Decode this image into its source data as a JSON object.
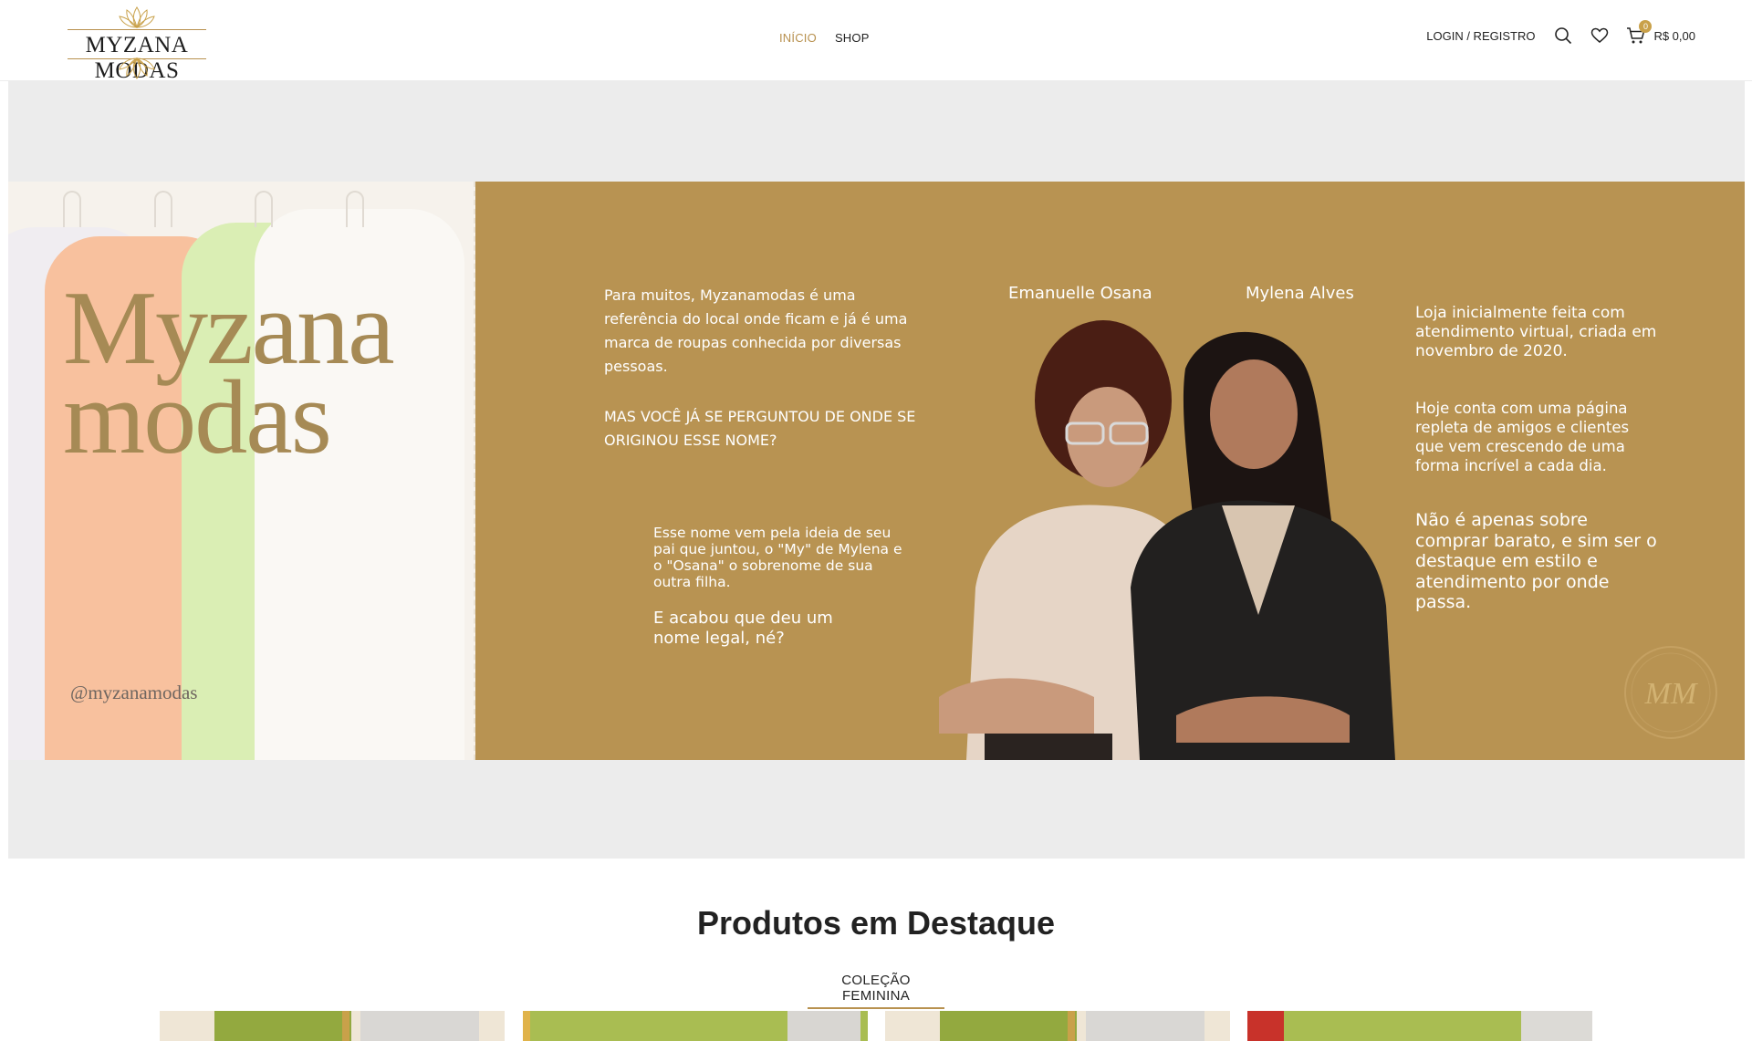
{
  "header": {
    "logo_text": "MYZANA MODAS",
    "nav": [
      {
        "label": "INÍCIO",
        "active": true
      },
      {
        "label": "SHOP",
        "active": false
      }
    ],
    "login_label": "LOGIN / REGISTRO",
    "cart_count": "0",
    "cart_total": "R$ 0,00",
    "icons": [
      "search-icon",
      "heart-icon",
      "cart-icon"
    ]
  },
  "banner": {
    "brand_line1": "Myzana",
    "brand_line2": "modas",
    "handle": "@myzanamodas",
    "intro": "Para muitos, Myzanamodas é uma referência do local onde ficam e já é uma marca de roupas conhecida por diversas pessoas.",
    "question": "MAS VOCÊ JÁ SE PERGUNTOU DE ONDE SE ORIGINOU ESSE NOME?",
    "origin": "Esse nome vem pela ideia de seu pai que juntou, o \"My\" de Mylena e o \"Osana\" o sobrenome de sua outra filha.",
    "conclusion": "E acabou que deu um nome legal, né?",
    "person_left": "Emanuelle Osana",
    "person_right": "Mylena Alves",
    "history": "Loja inicialmente feita com atendimento virtual, criada em novembro de 2020.",
    "today": "Hoje conta com uma página repleta de amigos e clientes que vem crescendo de uma forma incrível a cada dia.",
    "mission": "Não é apenas sobre comprar barato, e sim ser o destaque em estilo e atendimento por onde passa.",
    "seal_text": "MM"
  },
  "featured": {
    "title": "Produtos em Destaque",
    "tab": "COLEÇÃO FEMININA"
  },
  "colors": {
    "accent": "#b8914f",
    "banner_bg": "#b89352",
    "hero_bg": "#ececec"
  }
}
